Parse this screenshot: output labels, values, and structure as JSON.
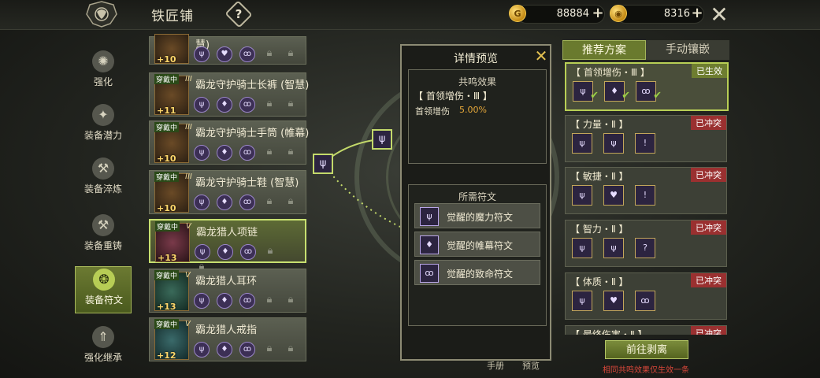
{
  "header": {
    "title": "铁匠铺",
    "help_label": "?",
    "gold": "88884",
    "gems": "8316"
  },
  "nav": {
    "items": [
      {
        "label": "强化",
        "icon": "strengthen-icon"
      },
      {
        "label": "装备潜力",
        "icon": "potential-icon"
      },
      {
        "label": "装备淬炼",
        "icon": "anvil-icon"
      },
      {
        "label": "装备重铸",
        "icon": "hammer-icon"
      },
      {
        "label": "装备符文",
        "icon": "rune-icon"
      },
      {
        "label": "强化继承",
        "icon": "inherit-icon"
      }
    ]
  },
  "items": [
    {
      "name": "慧)",
      "level": "+10",
      "tag": "",
      "tier": ""
    },
    {
      "name": "霸龙守护骑士长裤 (智慧)",
      "level": "+11",
      "tag": "穿戴中",
      "tier": "III"
    },
    {
      "name": "霸龙守护骑士手筒 (帷幕)",
      "level": "+10",
      "tag": "穿戴中",
      "tier": "III"
    },
    {
      "name": "霸龙守护骑士鞋 (智慧)",
      "level": "+10",
      "tag": "穿戴中",
      "tier": "III"
    },
    {
      "name": "霸龙猎人项链",
      "level": "+13",
      "tag": "穿戴中",
      "tier": "V"
    },
    {
      "name": "霸龙猎人耳环",
      "level": "+13",
      "tag": "穿戴中",
      "tier": "V"
    },
    {
      "name": "霸龙猎人戒指",
      "level": "+12",
      "tag": "穿戴中",
      "tier": "V"
    }
  ],
  "detail": {
    "title": "详情预览",
    "resonance_header": "共鸣效果",
    "resonance_name": "【 首领增伤・Ⅲ 】",
    "resonance_stat_label": "首领增伤",
    "resonance_stat_value": "5.00%",
    "required_header": "所需符文",
    "required_runes": [
      "觉醒的魔力符文",
      "觉醒的帷幕符文",
      "觉醒的致命符文"
    ]
  },
  "right_panel": {
    "tab_recommended": "推荐方案",
    "tab_manual": "手动镶嵌",
    "plans": [
      {
        "title": "【 首领增伤・Ⅲ 】",
        "status": "已生效"
      },
      {
        "title": "【 力量・Ⅱ 】",
        "status": "已冲突"
      },
      {
        "title": "【 敏捷・Ⅱ 】",
        "status": "已冲突"
      },
      {
        "title": "【 智力・Ⅱ 】",
        "status": "已冲突"
      },
      {
        "title": "【 体质・Ⅱ 】",
        "status": "已冲突"
      },
      {
        "title": "【 最终伤害・Ⅱ 】",
        "status": "已冲突"
      }
    ],
    "goto_button": "前往剥离",
    "footnote": "相同共鸣效果仅生效一条"
  },
  "bottom": {
    "manual": "手册",
    "preview": "预览"
  },
  "colors": {
    "accent": "#b8cf55",
    "conflict": "#9a3030",
    "gold": "#e6c352"
  }
}
